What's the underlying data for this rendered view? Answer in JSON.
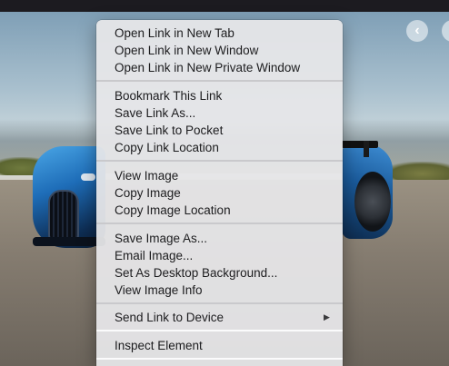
{
  "context_menu": {
    "items": [
      {
        "label": "Open Link in New Tab"
      },
      {
        "label": "Open Link in New Window"
      },
      {
        "label": "Open Link in New Private Window"
      },
      {
        "label": "Bookmark This Link"
      },
      {
        "label": "Save Link As..."
      },
      {
        "label": "Save Link to Pocket"
      },
      {
        "label": "Copy Link Location"
      },
      {
        "label": "View Image"
      },
      {
        "label": "Copy Image"
      },
      {
        "label": "Copy Image Location"
      },
      {
        "label": "Save Image As..."
      },
      {
        "label": "Email Image..."
      },
      {
        "label": "Set As Desktop Background..."
      },
      {
        "label": "View Image Info"
      },
      {
        "label": "Send Link to Device",
        "has_submenu": true,
        "submenu_icon": "triangle-right-icon"
      },
      {
        "label": "Inspect Element"
      }
    ]
  },
  "page": {
    "image_subject": "car-photo",
    "nav_prev_icon": "chevron-left-icon",
    "nav_next_icon": "chevron-right-icon"
  },
  "colors": {
    "menu_background": "#e7e7e9",
    "menu_text": "#1c1c1e",
    "separator": "#c9c9cc",
    "top_bar": "#1c1b20"
  }
}
